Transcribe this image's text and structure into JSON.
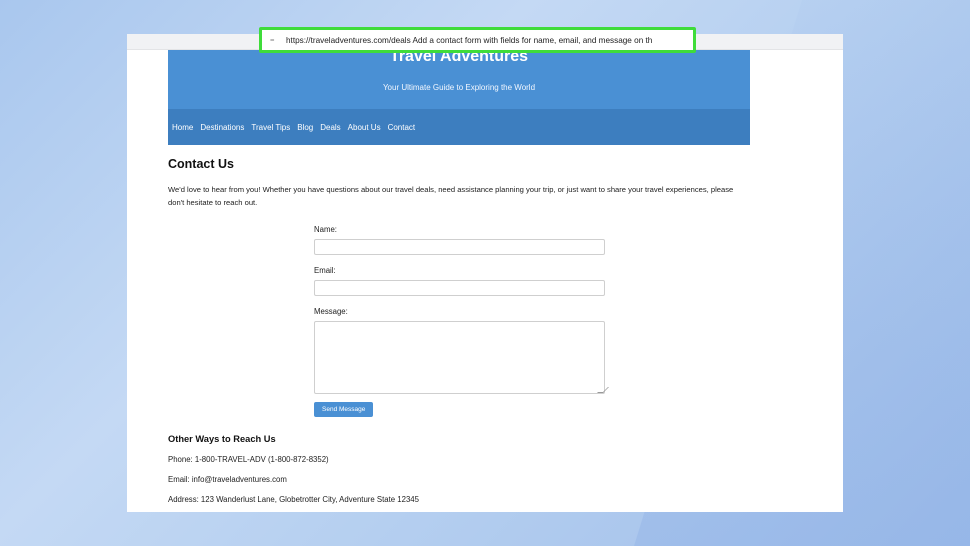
{
  "browser": {
    "url_icon": "tune-icon",
    "url_text": "https://traveladventures.com/deals Add a contact form with fields for name, email, and message on the c"
  },
  "site": {
    "title": "Travel Adventures",
    "subtitle": "Your Ultimate Guide to Exploring the World",
    "nav": [
      "Home",
      "Destinations",
      "Travel Tips",
      "Blog",
      "Deals",
      "About Us",
      "Contact"
    ]
  },
  "contact": {
    "heading": "Contact Us",
    "intro": "We'd love to hear from you! Whether you have questions about our travel deals, need assistance planning your trip, or just want to share your travel experiences, please don't hesitate to reach out.",
    "form": {
      "name_label": "Name:",
      "email_label": "Email:",
      "message_label": "Message:",
      "name_value": "",
      "email_value": "",
      "message_value": "",
      "submit_label": "Send Message"
    },
    "other_heading": "Other Ways to Reach Us",
    "phone": "Phone: 1-800-TRAVEL-ADV (1-800-872-8352)",
    "email": "Email: info@traveladventures.com",
    "address": "Address: 123 Wanderlust Lane, Globetrotter City, Adventure State 12345"
  },
  "colors": {
    "highlight": "#3fdc3a",
    "hero": "#4a90d4",
    "nav": "#3d7ebf",
    "button": "#4a90d4"
  }
}
